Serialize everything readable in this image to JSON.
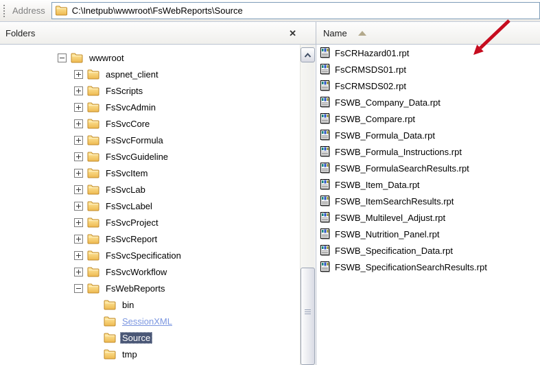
{
  "window": {
    "address_label": "Address",
    "address_path": "C:\\Inetpub\\wwwroot\\FsWebReports\\Source"
  },
  "left_pane": {
    "title": "Folders",
    "close_icon": "✕"
  },
  "tree": {
    "items": [
      {
        "label": "wwwroot",
        "level": 0,
        "toggle": "minus",
        "state": "normal"
      },
      {
        "label": "aspnet_client",
        "level": 1,
        "toggle": "plus",
        "state": "normal"
      },
      {
        "label": "FsScripts",
        "level": 1,
        "toggle": "plus",
        "state": "normal"
      },
      {
        "label": "FsSvcAdmin",
        "level": 1,
        "toggle": "plus",
        "state": "normal"
      },
      {
        "label": "FsSvcCore",
        "level": 1,
        "toggle": "plus",
        "state": "normal"
      },
      {
        "label": "FsSvcFormula",
        "level": 1,
        "toggle": "plus",
        "state": "normal"
      },
      {
        "label": "FsSvcGuideline",
        "level": 1,
        "toggle": "plus",
        "state": "normal"
      },
      {
        "label": "FsSvcItem",
        "level": 1,
        "toggle": "plus",
        "state": "normal"
      },
      {
        "label": "FsSvcLab",
        "level": 1,
        "toggle": "plus",
        "state": "normal"
      },
      {
        "label": "FsSvcLabel",
        "level": 1,
        "toggle": "plus",
        "state": "normal"
      },
      {
        "label": "FsSvcProject",
        "level": 1,
        "toggle": "plus",
        "state": "normal"
      },
      {
        "label": "FsSvcReport",
        "level": 1,
        "toggle": "plus",
        "state": "normal"
      },
      {
        "label": "FsSvcSpecification",
        "level": 1,
        "toggle": "plus",
        "state": "normal"
      },
      {
        "label": "FsSvcWorkflow",
        "level": 1,
        "toggle": "plus",
        "state": "normal"
      },
      {
        "label": "FsWebReports",
        "level": 1,
        "toggle": "minus",
        "state": "normal"
      },
      {
        "label": "bin",
        "level": 2,
        "toggle": "none",
        "state": "normal"
      },
      {
        "label": "SessionXML",
        "level": 2,
        "toggle": "none",
        "state": "link"
      },
      {
        "label": "Source",
        "level": 2,
        "toggle": "none",
        "state": "selected"
      },
      {
        "label": "tmp",
        "level": 2,
        "toggle": "none",
        "state": "normal"
      }
    ]
  },
  "file_list": {
    "column_header": "Name",
    "sort_order": "ascending",
    "files": [
      "FsCRHazard01.rpt",
      "FsCRMSDS01.rpt",
      "FsCRMSDS02.rpt",
      "FSWB_Company_Data.rpt",
      "FSWB_Compare.rpt",
      "FSWB_Formula_Data.rpt",
      "FSWB_Formula_Instructions.rpt",
      "FSWB_FormulaSearchResults.rpt",
      "FSWB_Item_Data.rpt",
      "FSWB_ItemSearchResults.rpt",
      "FSWB_Multilevel_Adjust.rpt",
      "FSWB_Nutrition_Panel.rpt",
      "FSWB_Specification_Data.rpt",
      "FSWB_SpecificationSearchResults.rpt"
    ]
  },
  "annotation": {
    "type": "red-arrow"
  },
  "colors": {
    "selection_bg": "#4a5776",
    "link_blue": "#7b96e0",
    "arrow_red": "#c60c1f",
    "field_border": "#7f9db9",
    "sort_arrow": "#b3a98c"
  }
}
